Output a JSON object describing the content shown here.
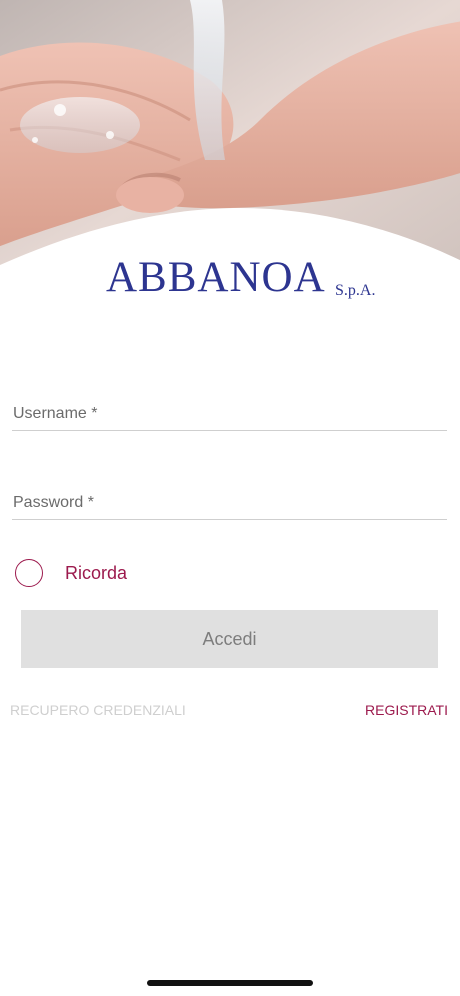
{
  "brand": {
    "name": "ABBANOA",
    "suffix": "S.p.A.",
    "color": "#2d3590",
    "accent_color": "#9c1a4d"
  },
  "hero": {
    "image": "hands-with-water-photo"
  },
  "form": {
    "username_label": "Username *",
    "password_label": "Password *",
    "remember_label": "Ricorda",
    "login_button": "Accedi"
  },
  "links": {
    "recovery": "RECUPERO CREDENZIALI",
    "register": "REGISTRATI"
  }
}
